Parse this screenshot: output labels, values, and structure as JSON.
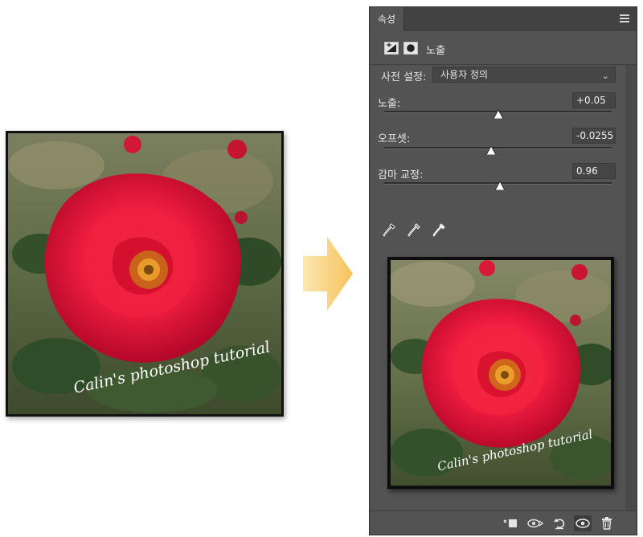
{
  "panel": {
    "tab_label": "속성",
    "adjustment_title": "노출",
    "preset": {
      "label": "사전 설정:",
      "value": "사용자 정의"
    },
    "exposure": {
      "label": "노출:",
      "value": "+0.05",
      "position": 0.5
    },
    "offset": {
      "label": "오프셋:",
      "value": "-0.0255",
      "position": 0.47
    },
    "gamma": {
      "label": "감마 교정:",
      "value": "0.96",
      "position": 0.51
    }
  },
  "watermark": {
    "text": "Calin's photoshop tutorial"
  },
  "colors": {
    "panel_bg": "#535353",
    "rose": "#e8163a",
    "arrow": "#fbd68c"
  },
  "bottom_toolbar": [
    {
      "name": "clip-to-layer-icon"
    },
    {
      "name": "view-previous-state-icon"
    },
    {
      "name": "reset-icon"
    },
    {
      "name": "visibility-eye-icon"
    },
    {
      "name": "trash-icon"
    }
  ]
}
